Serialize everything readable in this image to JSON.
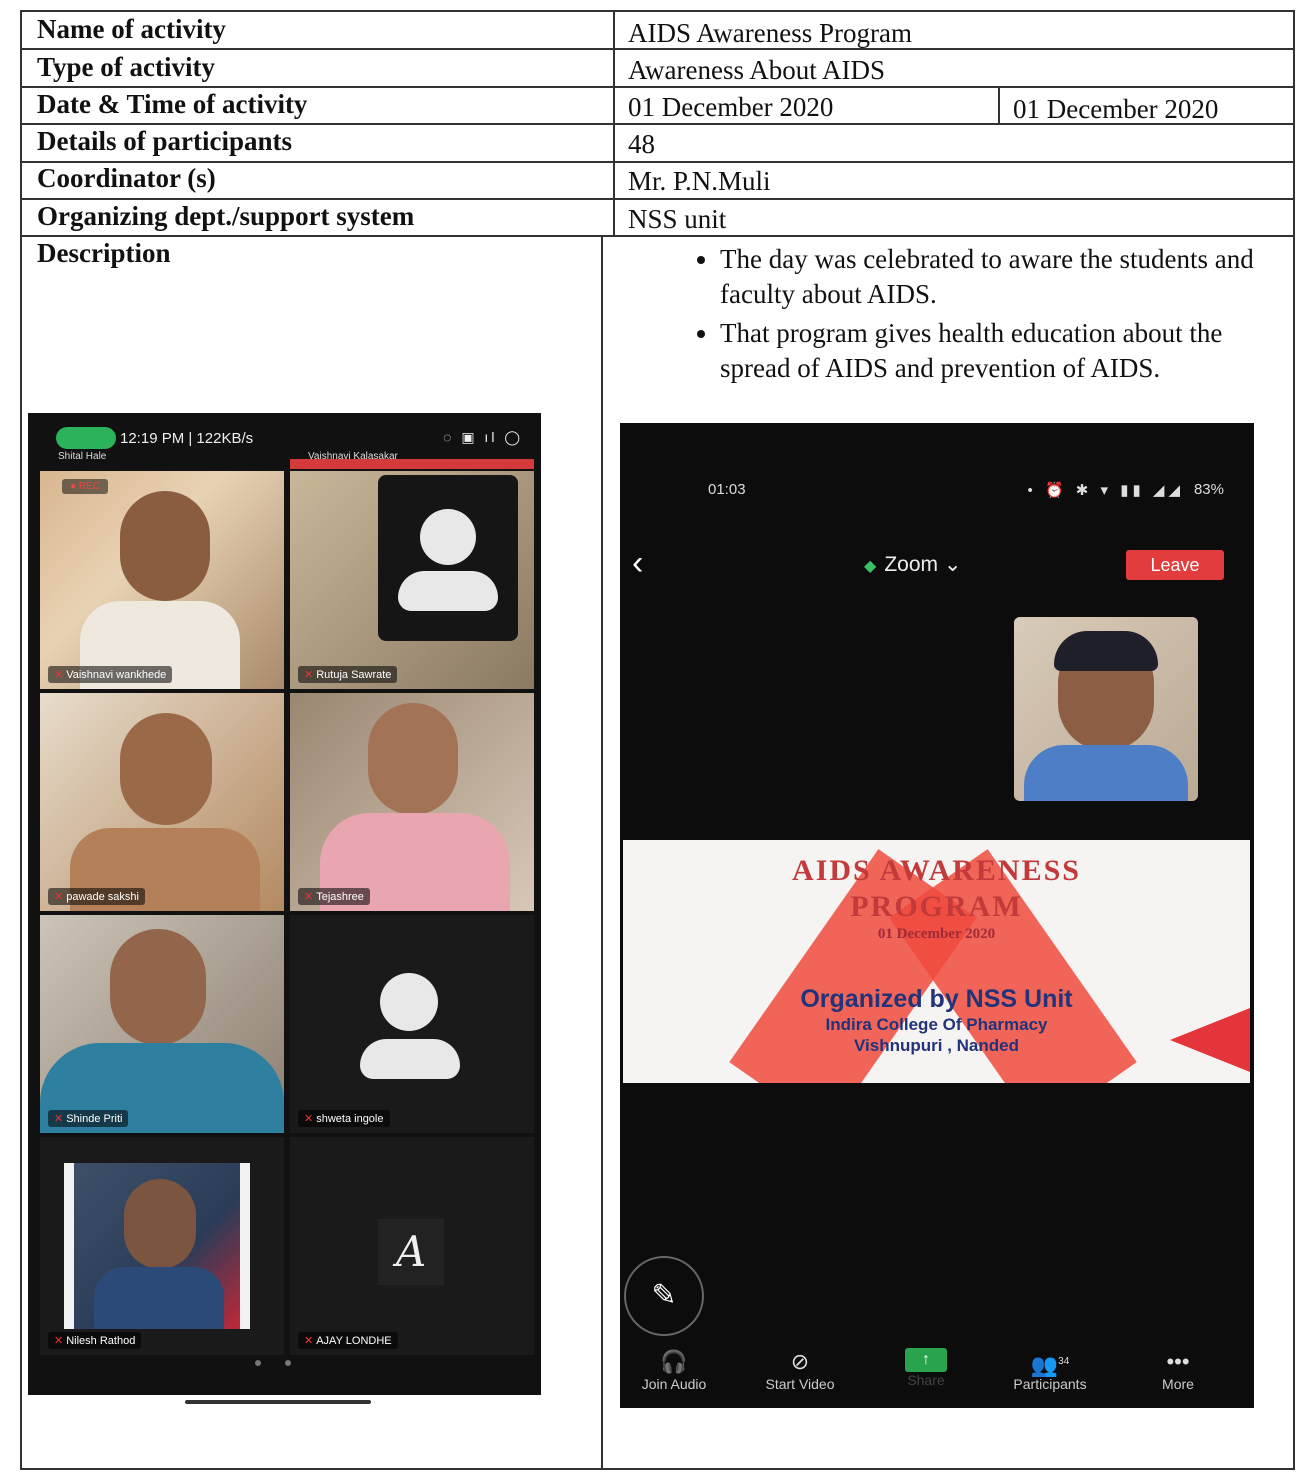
{
  "table": {
    "rows": [
      {
        "label": "Name of activity",
        "value": "AIDS Awareness Program"
      },
      {
        "label": "Type of activity",
        "value": "Awareness About AIDS"
      },
      {
        "label": "Date & Time of activity",
        "value": "01 December 2020",
        "value2": "01 December 2020"
      },
      {
        "label": "Details of participants",
        "value": "48"
      },
      {
        "label": "Coordinator (s)",
        "value": "Mr. P.N.Muli"
      },
      {
        "label": "Organizing dept./support system",
        "value": "NSS unit"
      }
    ],
    "description_label": "Description",
    "description_points": [
      "The day was celebrated to aware the students and faculty about AIDS.",
      "That program gives health education about the spread of AIDS and prevention of AIDS."
    ]
  },
  "phone_left": {
    "status_time": "12:19 PM | 122KB/s",
    "rec": "● REC",
    "top_names": [
      "Shital Hale",
      "Vaishnavi Kalasakar"
    ],
    "participants": [
      "Vaishnavi wankhede",
      "Rutuja Sawrate",
      "pawade sakshi",
      "Tejashree",
      "Shinde Priti",
      "shweta ingole",
      "Nilesh Rathod",
      "AJAY LONDHE"
    ],
    "initial": "A",
    "colors": {
      "mic_pill": "#2ab35a"
    }
  },
  "phone_right": {
    "status_time": "01:03",
    "battery": "83%",
    "app_title": "Zoom",
    "leave_label": "Leave",
    "slide": {
      "title_line1": "AIDS AWARENESS",
      "title_line2": "PROGRAM",
      "date": "01 December 2020",
      "organized": "Organized by NSS Unit",
      "college": "Indira College Of Pharmacy",
      "location": "Vishnupuri , Nanded"
    },
    "toolbar": [
      {
        "label": "Join Audio",
        "icon": "headphones-icon"
      },
      {
        "label": "Start Video",
        "icon": "video-off-icon"
      },
      {
        "label": "Share",
        "icon": "share-icon"
      },
      {
        "label": "Participants",
        "icon": "participants-icon",
        "badge": "34"
      },
      {
        "label": "More",
        "icon": "more-icon"
      }
    ],
    "colors": {
      "leave": "#e23c3c",
      "share": "#2aa34f",
      "slide_red": "#c23a3a",
      "slide_blue": "#22337a"
    }
  }
}
